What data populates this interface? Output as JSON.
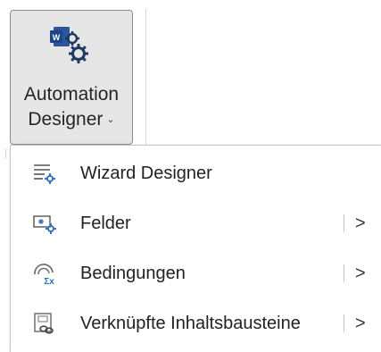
{
  "ribbon": {
    "button": {
      "label_line1": "Automation",
      "label_line2": "Designer",
      "caret": "⌄",
      "icon": "word-gears-icon"
    }
  },
  "menu": {
    "items": [
      {
        "label": "Wizard Designer",
        "icon": "wizard-designer-icon",
        "has_submenu": false
      },
      {
        "label": "Felder",
        "icon": "fields-icon",
        "has_submenu": true,
        "arrow": ">"
      },
      {
        "label": "Bedingungen",
        "icon": "conditions-icon",
        "has_submenu": true,
        "arrow": ">"
      },
      {
        "label": "Verknüpfte Inhaltsbausteine",
        "icon": "linked-building-blocks-icon",
        "has_submenu": true,
        "arrow": ">"
      }
    ]
  },
  "colors": {
    "word_blue": "#2b579a",
    "gear_dark": "#1f3864",
    "icon_blue": "#2f74c0",
    "pressed_background": "#e6e6e6"
  }
}
